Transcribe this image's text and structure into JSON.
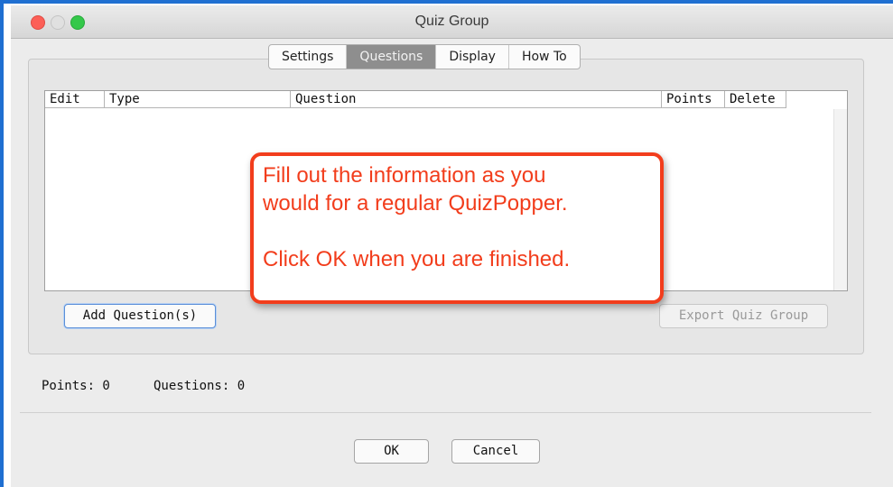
{
  "window": {
    "title": "Quiz Group"
  },
  "tabs": [
    {
      "label": "Settings",
      "active": false
    },
    {
      "label": "Questions",
      "active": true
    },
    {
      "label": "Display",
      "active": false
    },
    {
      "label": "How To",
      "active": false
    }
  ],
  "table": {
    "columns": [
      "Edit",
      "Type",
      "Question",
      "Points",
      "Delete"
    ],
    "rows": []
  },
  "buttons": {
    "add_questions": "Add Question(s)",
    "export_quiz_group": "Export Quiz Group",
    "ok": "OK",
    "cancel": "Cancel"
  },
  "status": {
    "points": "Points: 0",
    "questions": "Questions: 0"
  },
  "callout": {
    "line1": "Fill out the information as you",
    "line2": "would for a regular QuizPopper.",
    "line3": "Click OK when you are finished."
  },
  "colors": {
    "callout_accent": "#f23d1c",
    "active_tab": "#8e8e8e",
    "focus_ring": "#5b8fd8",
    "frame_accent": "#1f6fd1"
  }
}
